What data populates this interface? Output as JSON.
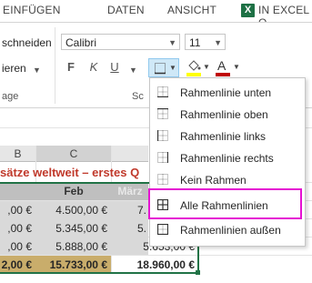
{
  "ribbon_tabs": [
    "EINFÜGEN",
    "DATEN",
    "ANSICHT",
    "IN EXCEL O"
  ],
  "excel_badge": "X",
  "clipboard": {
    "cut_label": "schneiden",
    "copy_label": "ieren",
    "group_label": "age"
  },
  "font": {
    "name": "Calibri",
    "size": "11",
    "bold": "F",
    "italic": "K",
    "underline": "U",
    "font_color_letter": "A",
    "group_label_partial": "Sc"
  },
  "sheet": {
    "column_headers": [
      "B",
      "C"
    ],
    "title_text": "sätze weltweit – erstes Q",
    "month_headers": [
      "Feb",
      "März"
    ],
    "rows": [
      {
        "b": ",00 €",
        "c": "4.500,00 €",
        "d": "7."
      },
      {
        "b": ",00 €",
        "c": "5.345,00 €",
        "d": "5."
      },
      {
        "b": ",00 €",
        "c": "5.888,00 €",
        "d": "5.653,00 €"
      },
      {
        "b": "2,00 €",
        "c": "15.733,00 €",
        "d": "18.960,00 €"
      }
    ]
  },
  "border_menu": {
    "items": [
      {
        "label": "Rahmenlinie unten",
        "icon": "border-bottom-icon"
      },
      {
        "label": "Rahmenlinie oben",
        "icon": "border-top-icon"
      },
      {
        "label": "Rahmenlinie links",
        "icon": "border-left-icon"
      },
      {
        "label": "Rahmenlinie rechts",
        "icon": "border-right-icon"
      },
      {
        "label": "Kein Rahmen",
        "icon": "no-border-icon"
      },
      {
        "label": "Alle Rahmenlinien",
        "icon": "all-borders-icon"
      },
      {
        "label": "Rahmenlinien außen",
        "icon": "outside-borders-icon"
      }
    ],
    "highlighted_item": "Alle Rahmenlinien"
  },
  "colors": {
    "title_text": "#c0392b",
    "total_row_fill": "#c9ad6b",
    "header_fill": "#bfbfbf",
    "highlight_border": "#e512d2",
    "excel_green": "#1e7145",
    "font_color_bar": "#c00000",
    "fill_color_bar": "#ffff00"
  }
}
